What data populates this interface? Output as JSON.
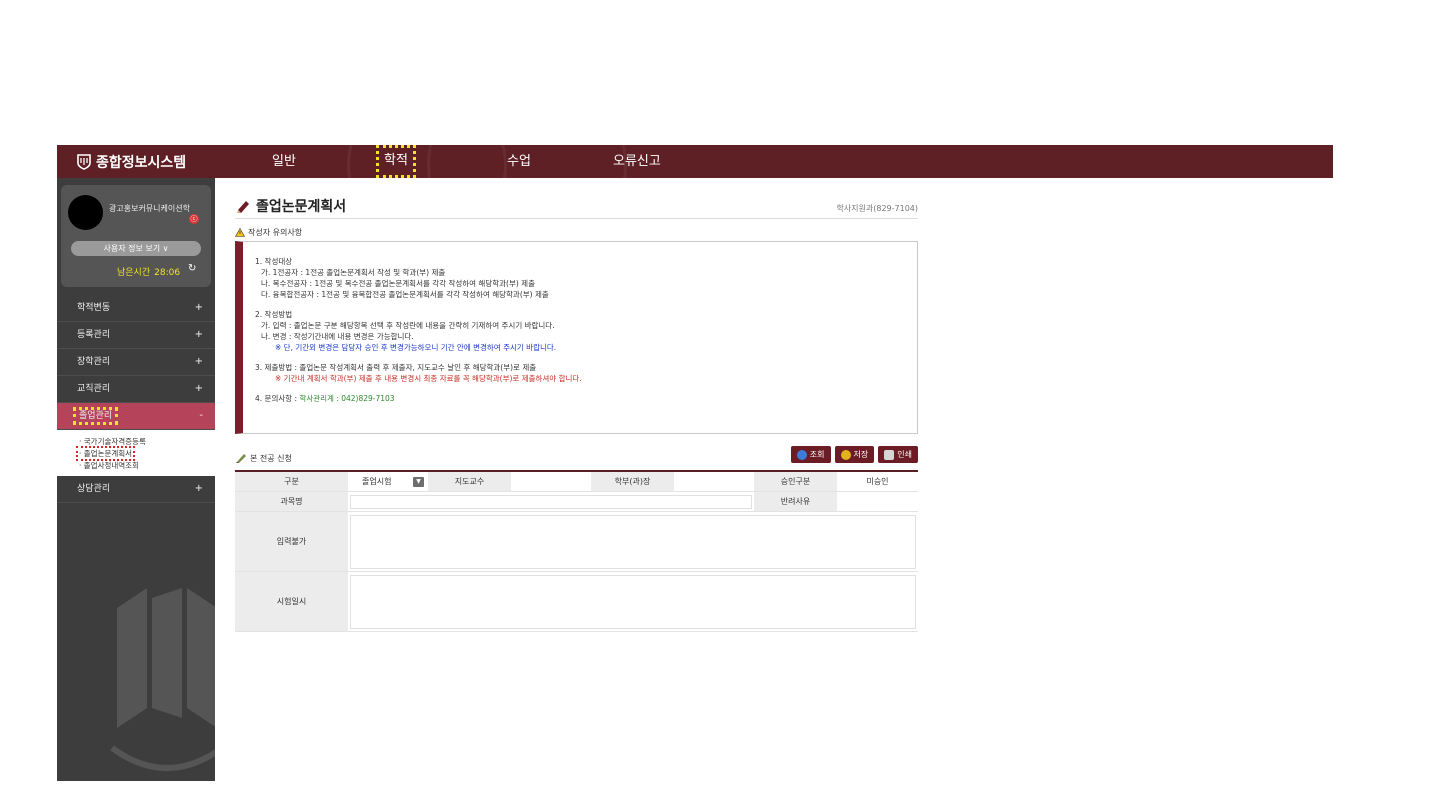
{
  "topbar": {
    "logo_text": "종합정보시스템",
    "nav": [
      "일반",
      "학적",
      "수업",
      "오류신고"
    ],
    "active_nav": "학적",
    "bg_color": "#5e1f25"
  },
  "sidebar": {
    "dept": "광고홍보커뮤니케이션학",
    "logout_icon": "ⓒ",
    "user_info_button": "사용자 정보 보기   ∨",
    "remaining_label": "남은시간",
    "remaining_time": "28:06",
    "refresh_icon": "↻",
    "menu": [
      {
        "label": "학적변동",
        "toggle": "+"
      },
      {
        "label": "등록관리",
        "toggle": "+"
      },
      {
        "label": "장학관리",
        "toggle": "+"
      },
      {
        "label": "교직관리",
        "toggle": "+"
      },
      {
        "label": "졸업관리",
        "toggle": "-"
      },
      {
        "label": "상담관리",
        "toggle": "+"
      }
    ],
    "submenu": [
      "· 국가기술자격증등록",
      "· 졸업논문계획서",
      "· 졸업사정내역조회"
    ],
    "accent_color": "#b5435a"
  },
  "main": {
    "title": "졸업논문계획서",
    "contact": "학사지원과(829-7104)",
    "notice_heading": "작성자 유의사항",
    "notice": {
      "s1_title": "1. 작성대상",
      "s1_a": "가. 1전공자 : 1전공 졸업논문계획서 작성 및 학과(부) 제출",
      "s1_b": "나. 복수전공자 : 1전공 및 복수전공 졸업논문계획서를 각각 작성하여 해당학과(부) 제출",
      "s1_c": "다. 융복합전공자 : 1전공 및 융복합전공 졸업논문계획서를 각각 작성하여 해당학과(부) 제출",
      "s2_title": "2. 작성방법",
      "s2_a": "가. 입력 : 졸업논문 구분 해당항목 선택 후 작성란에 내용을 간략히 기재하여 주시기 바랍니다.",
      "s2_b": "나. 변경 : 작성기간내에 내용 변경은 가능합니다.",
      "s2_note": "※ 단, 기간외 변경은 담당자 승인 후 변경가능하오니 기간 안에 변경하여 주시기 바랍니다.",
      "s3_title": "3. 제출방법 : 졸업논문 작성계획서 출력 후 제출자, 지도교수 날인 후 해당학과(부)로 제출",
      "s3_note": "※ 기간내 계획서 학과(부) 제출 후 내용 변경시 최종 자료를 꼭 해당학과(부)로 제출하셔야 합니다.",
      "s4_label": "4. 문의사항 : ",
      "s4_value": "학사관리계 : 042)829-7103"
    },
    "application_heading": "본 전공 신청",
    "buttons": {
      "search": "조회",
      "save": "저장",
      "print": "인쇄"
    },
    "form": {
      "type_label": "구분",
      "type_value": "졸업시험",
      "advisor_label": "지도교수",
      "advisor_value": "",
      "head_label": "학부(과)장",
      "head_value": "",
      "approval_label": "승인구분",
      "approval_value": "미승인",
      "subject_label": "과목명",
      "subject_value": "",
      "reject_label": "반려사유",
      "input_label": "입력불가",
      "exam_date_label": "시험일시"
    }
  }
}
